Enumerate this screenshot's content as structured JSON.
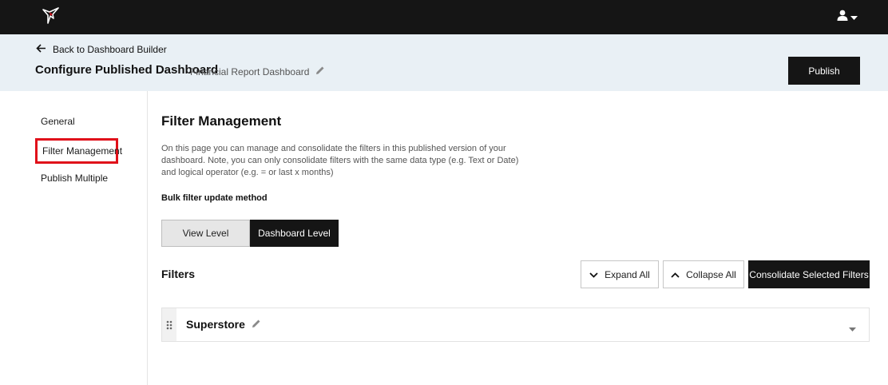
{
  "topbar": {
    "logo_icon": "hummingbird-logo-icon",
    "user_icon": "user-icon",
    "user_caret_icon": "caret-down-icon"
  },
  "header": {
    "back_label": "Back to Dashboard Builder",
    "title": "Configure Published Dashboard",
    "dashboard_name": "Financial Report Dashboard",
    "publish_label": "Publish"
  },
  "sidebar": {
    "items": [
      {
        "label": "General",
        "active": false
      },
      {
        "label": "Filter Management",
        "active": true
      },
      {
        "label": "Publish Multiple",
        "active": false
      }
    ],
    "highlight_color": "#e0101a"
  },
  "main": {
    "title": "Filter Management",
    "description": "On this page you can manage and consolidate the filters in this published version of your dashboard. Note, you can only consolidate filters with the same data type (e.g. Text or Date) and logical operator (e.g. = or last x months)",
    "bulk_label": "Bulk filter update method",
    "bulk_options": [
      {
        "label": "View Level",
        "selected": false
      },
      {
        "label": "Dashboard Level",
        "selected": true
      }
    ],
    "filters_title": "Filters",
    "expand_all_label": "Expand All",
    "collapse_all_label": "Collapse All",
    "consolidate_label": "Consolidate Selected Filters",
    "filter_groups": [
      {
        "name": "Superstore",
        "expanded": false
      }
    ]
  },
  "colors": {
    "topbar_bg": "#151515",
    "header_bg": "#e9f0f5",
    "primary_button": "#151515",
    "logo_accent": "#d0101c"
  }
}
